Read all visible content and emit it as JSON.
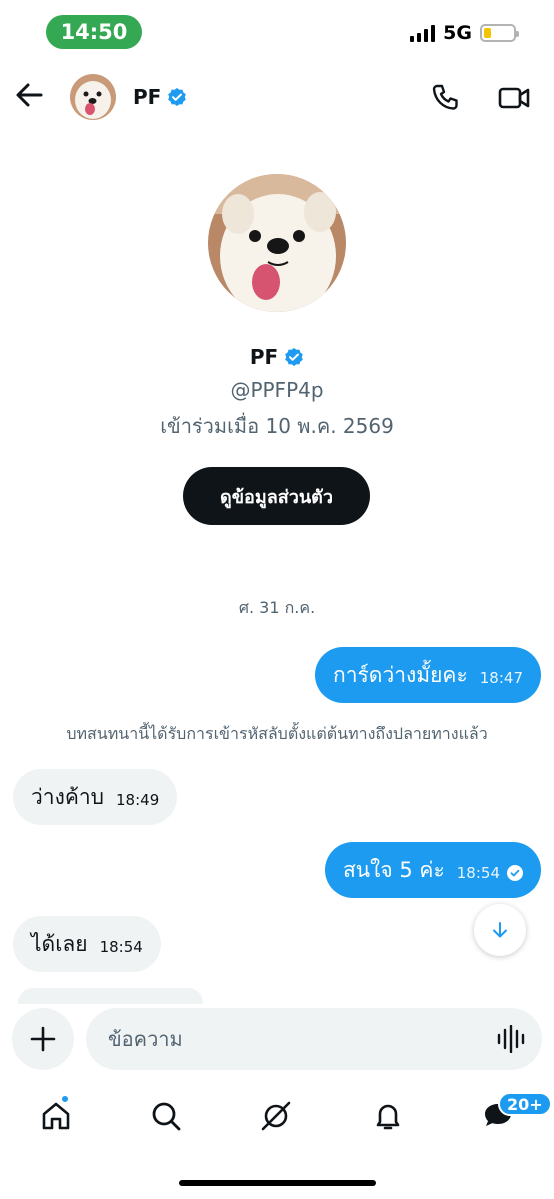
{
  "status_bar": {
    "time": "14:50",
    "network": "5G",
    "battery_level": 0.25,
    "signal_bars": 4
  },
  "header": {
    "name": "PF",
    "verified": true,
    "back_icon": "arrow-left-icon",
    "call_icon": "phone-icon",
    "video_icon": "video-camera-icon"
  },
  "profile": {
    "name": "PF",
    "handle": "@PPFP4p",
    "joined": "เข้าร่วมเมื่อ 10 พ.ค. 2569",
    "view_profile_label": "ดูข้อมูลส่วนตัว"
  },
  "conversation": {
    "date_separator": "ศ. 31 ก.ค.",
    "encryption_note": "บทสนทนานี้ได้รับการเข้ารหัสลับตั้งแต่ต้นทางถึงปลายทางแล้ว",
    "messages": [
      {
        "direction": "out",
        "text": "การ์ดว่างมั้ยคะ",
        "time": "18:47"
      },
      {
        "direction": "in",
        "text": "ว่างค้าบ",
        "time": "18:49"
      },
      {
        "direction": "out",
        "text": "สนใจ 5 ค่ะ",
        "time": "18:54",
        "seen": true
      },
      {
        "direction": "in",
        "text": "ได้เลย",
        "time": "18:54"
      }
    ]
  },
  "composer": {
    "placeholder": "ข้อความ",
    "add_icon": "plus-icon",
    "voice_icon": "voice-wave-icon"
  },
  "bottom_nav": {
    "items": [
      "home-icon",
      "search-icon",
      "grok-icon",
      "bell-icon",
      "messages-icon"
    ],
    "messages_badge": "20+"
  },
  "colors": {
    "accent": "#1d9bf0",
    "status_pill": "#34a853",
    "dark_button": "#0f1419",
    "incoming_bubble": "#eff3f4"
  }
}
